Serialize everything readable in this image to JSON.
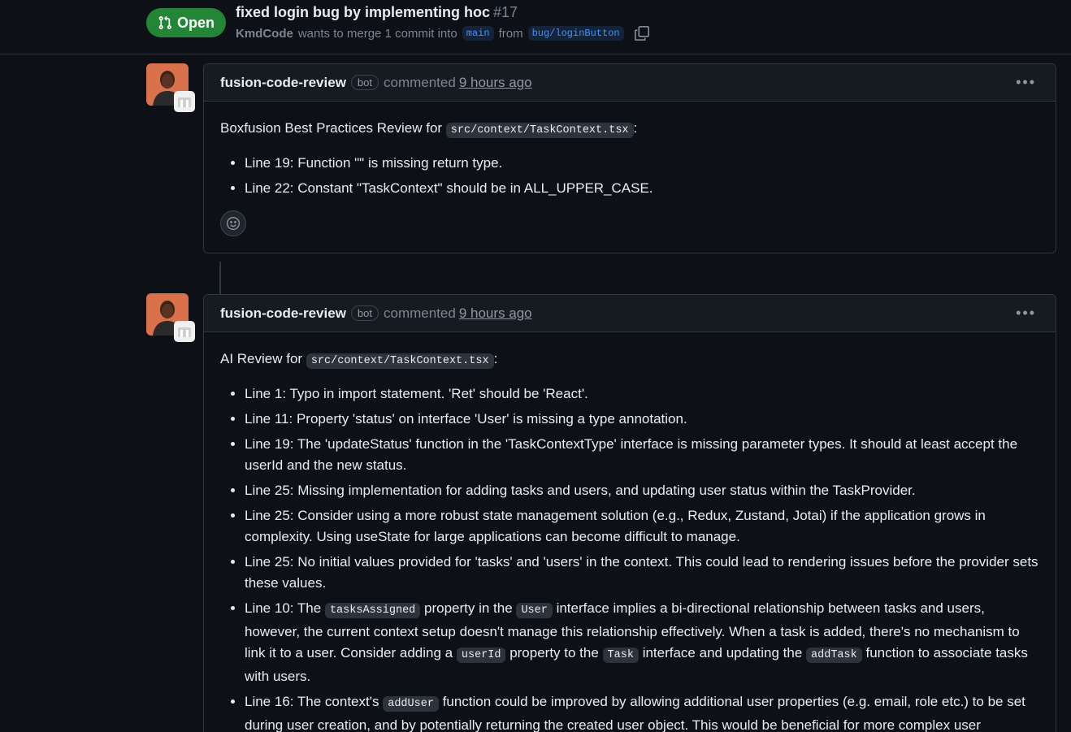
{
  "pr": {
    "state": "Open",
    "title": "fixed login bug by implementing hoc",
    "number": "#17",
    "author": "KmdCode",
    "merge_text": "wants to merge 1 commit into",
    "base_branch": "main",
    "from_text": "from",
    "head_branch": "bug/loginButton"
  },
  "comments": [
    {
      "user": "fusion-code-review",
      "bot_label": "bot",
      "action": "commented",
      "time": "9 hours ago",
      "intro": "Boxfusion Best Practices Review for",
      "file": "src/context/TaskContext.tsx",
      "items": [
        "Line 19: Function \"\" is missing return type.",
        "Line 22: Constant \"TaskContext\" should be in ALL_UPPER_CASE."
      ]
    },
    {
      "user": "fusion-code-review",
      "bot_label": "bot",
      "action": "commented",
      "time": "9 hours ago",
      "intro": "AI Review for",
      "file": "src/context/TaskContext.tsx",
      "items": [
        "Line 1: Typo in import statement. 'Ret' should be 'React'.",
        "Line 11: Property 'status' on interface 'User' is missing a type annotation.",
        "Line 19: The 'updateStatus' function in the 'TaskContextType' interface is missing parameter types. It should at least accept the userId and the new status.",
        "Line 25: Missing implementation for adding tasks and users, and updating user status within the TaskProvider.",
        "Line 25: Consider using a more robust state management solution (e.g., Redux, Zustand, Jotai) if the application grows in complexity. Using useState for large applications can become difficult to manage.",
        "Line 25: No initial values provided for 'tasks' and 'users' in the context. This could lead to rendering issues before the provider sets these values."
      ],
      "item_line10": {
        "a": "Line 10: The",
        "code1": "tasksAssigned",
        "b": "property in the",
        "code2": "User",
        "c": "interface implies a bi-directional relationship between tasks and users, however, the current context setup doesn't manage this relationship effectively. When a task is added, there's no mechanism to link it to a user. Consider adding a",
        "code3": "userId",
        "d": "property to the",
        "code4": "Task",
        "e": "interface and updating the",
        "code5": "addTask",
        "f": "function to associate tasks with users."
      },
      "item_line16": {
        "a": "Line 16: The context's",
        "code1": "addUser",
        "b": "function could be improved by allowing additional user properties (e.g. email, role etc.) to be set during user creation, and by potentially returning the created user object. This would be beneficial for more complex user"
      }
    }
  ],
  "colors": {
    "accent_green": "#238636",
    "link_blue": "#4493f8",
    "background": "#0d1117",
    "muted": "#7d8590"
  }
}
